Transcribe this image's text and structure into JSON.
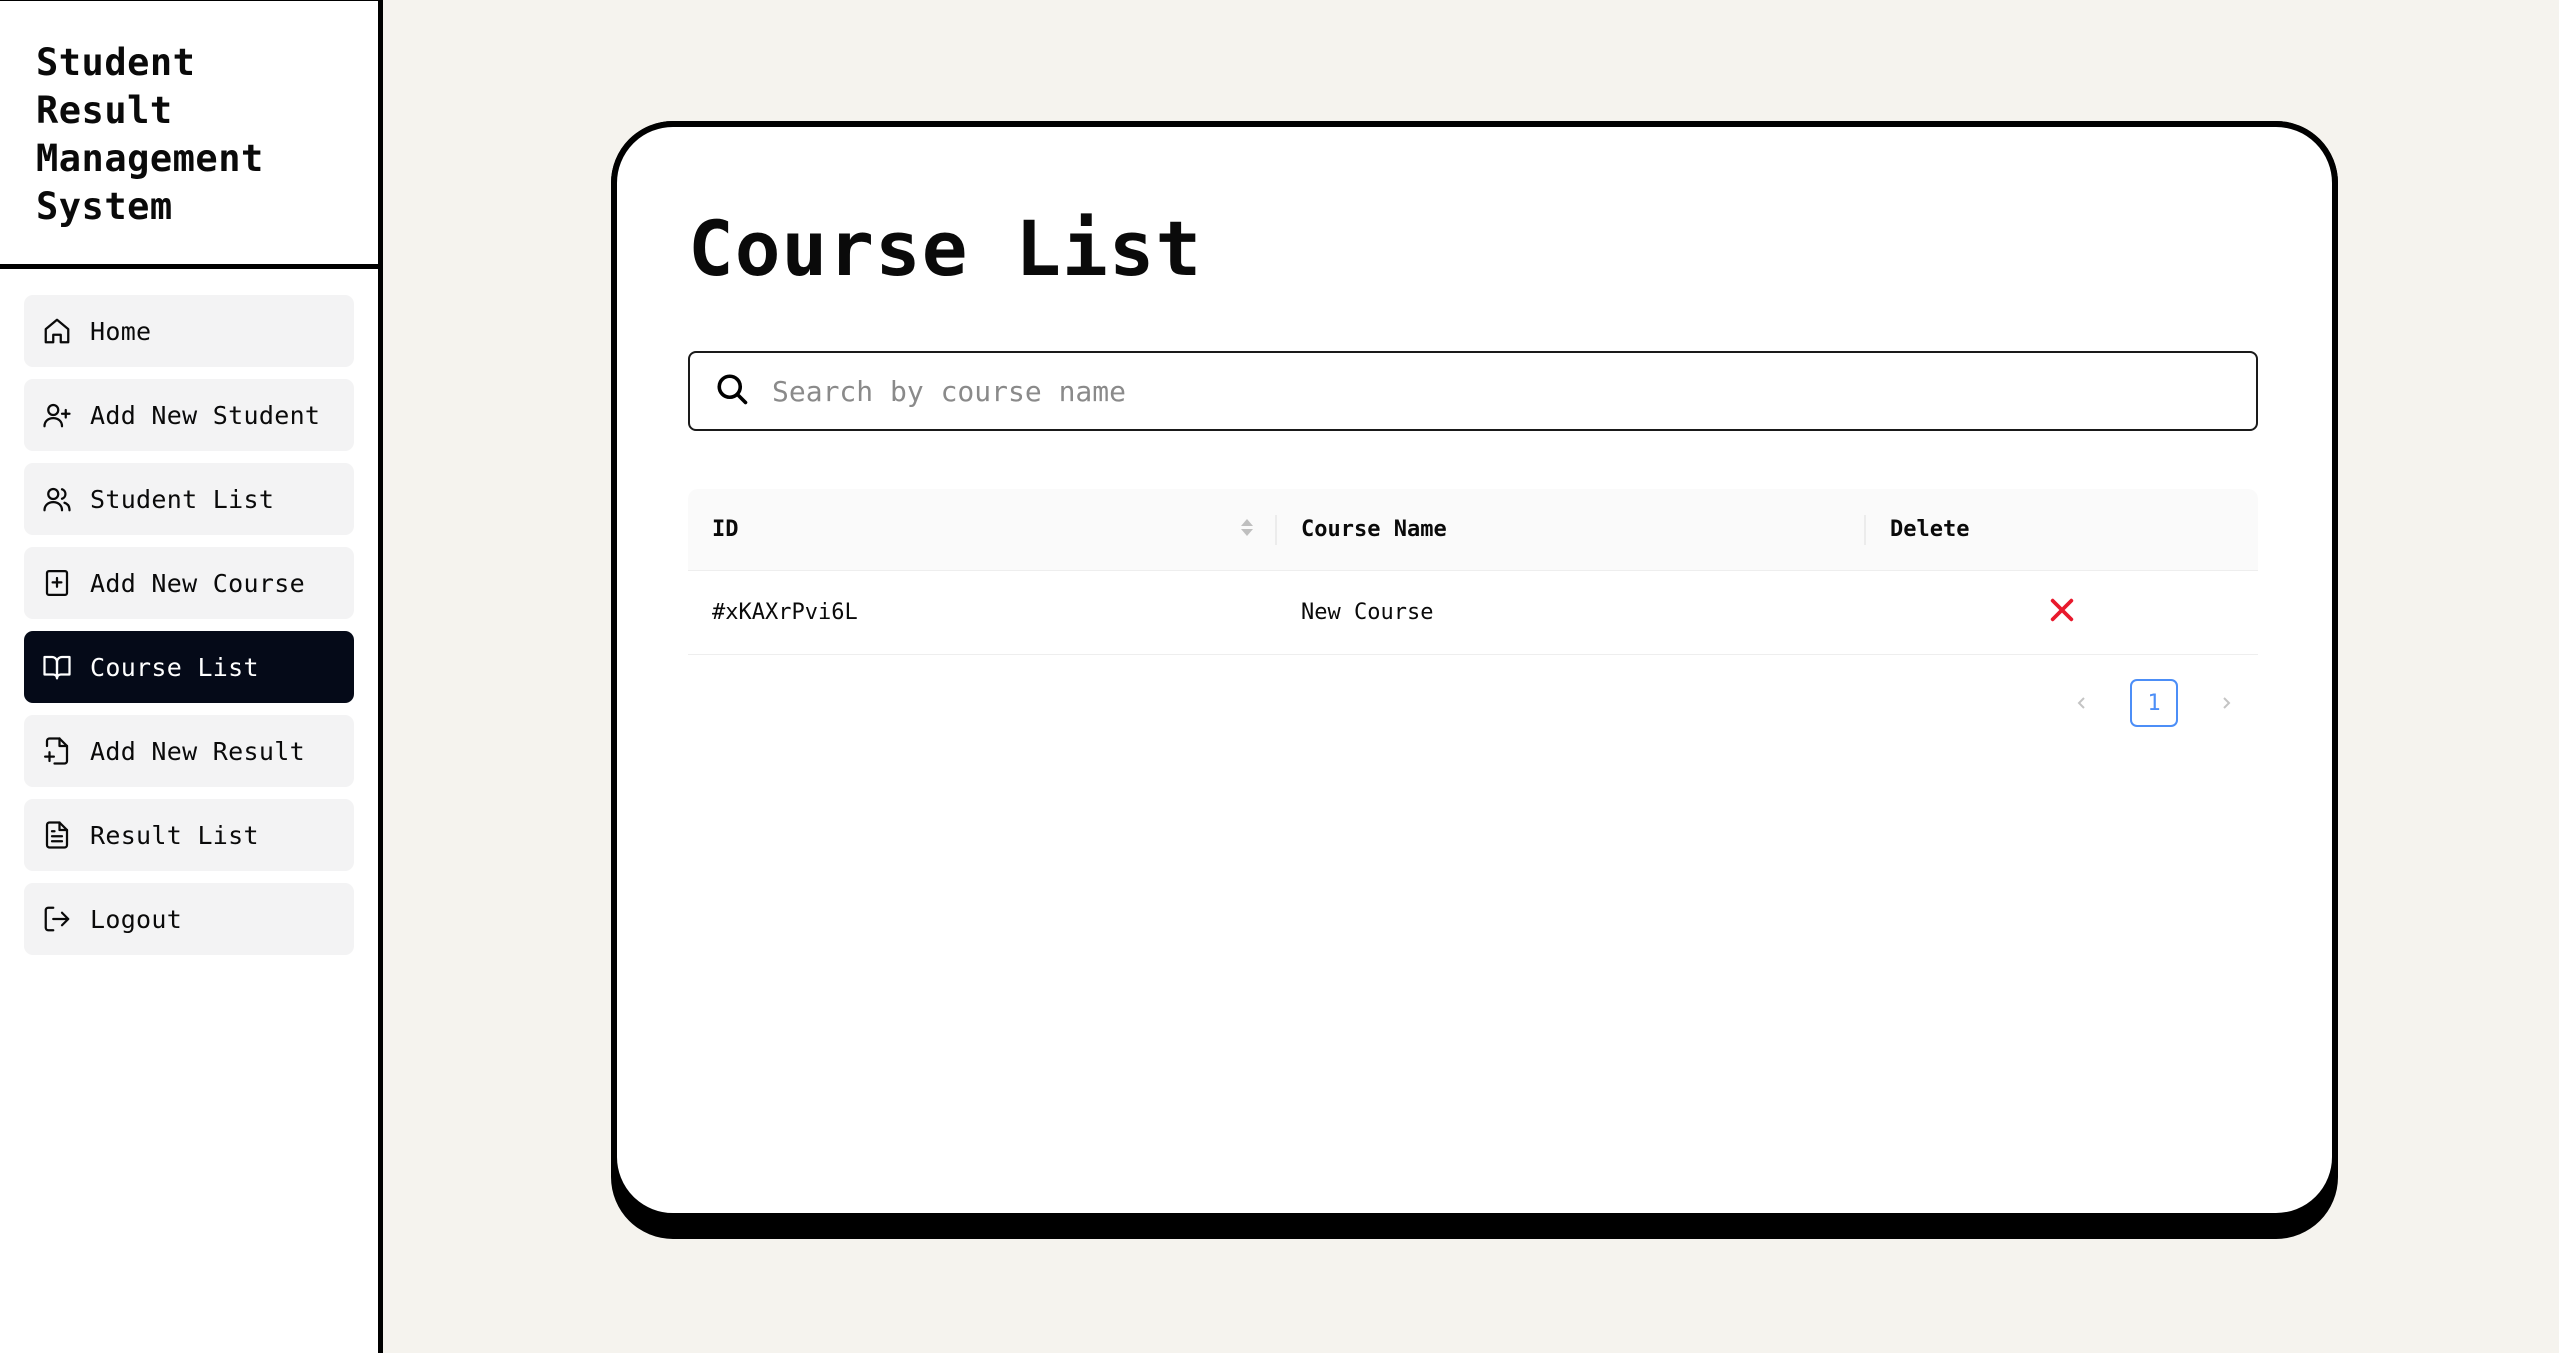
{
  "app": {
    "title": "Student Result Management System"
  },
  "sidebar": {
    "items": [
      {
        "label": "Home",
        "icon": "home-icon",
        "active": false
      },
      {
        "label": "Add New Student",
        "icon": "user-plus-icon",
        "active": false
      },
      {
        "label": "Student List",
        "icon": "users-icon",
        "active": false
      },
      {
        "label": "Add New Course",
        "icon": "book-plus-icon",
        "active": false
      },
      {
        "label": "Course List",
        "icon": "book-open-icon",
        "active": true
      },
      {
        "label": "Add New Result",
        "icon": "file-plus-icon",
        "active": false
      },
      {
        "label": "Result List",
        "icon": "file-text-icon",
        "active": false
      },
      {
        "label": "Logout",
        "icon": "logout-icon",
        "active": false
      }
    ]
  },
  "main": {
    "title": "Course List",
    "search": {
      "placeholder": "Search by course name",
      "value": ""
    },
    "table": {
      "columns": [
        "ID",
        "Course Name",
        "Delete"
      ],
      "rows": [
        {
          "id": "#xKAXrPvi6L",
          "name": "New Course"
        }
      ]
    },
    "pagination": {
      "current": "1"
    }
  },
  "colors": {
    "background": "#f5f3ee",
    "active_nav": "#050a18",
    "delete": "#e8192c",
    "pagination_accent": "#4c8ef7"
  }
}
